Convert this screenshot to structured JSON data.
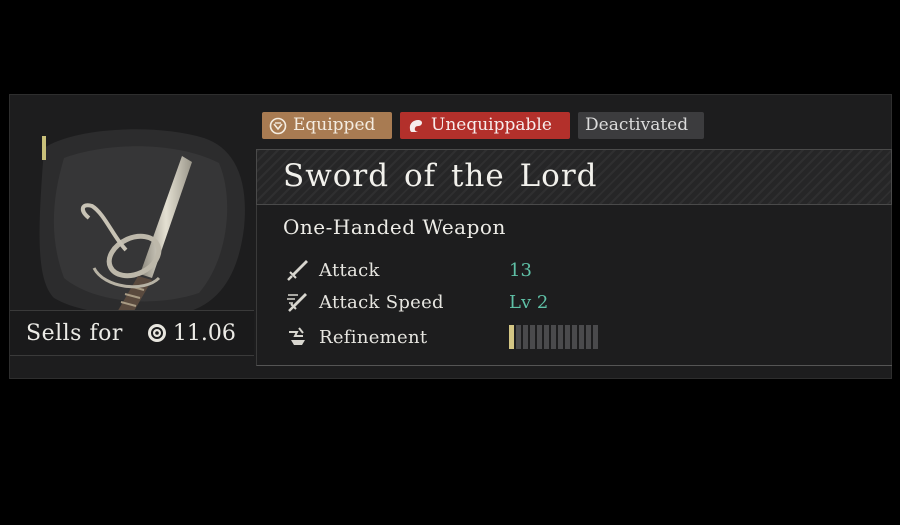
{
  "tags": {
    "equipped": {
      "label": "Equipped",
      "color": "#a87b52",
      "icon": "equipped-icon"
    },
    "unequippable": {
      "label": "Unequippable",
      "color": "#b3302b",
      "icon": "unequippable-icon"
    },
    "deactivated": {
      "label": "Deactivated",
      "color": "#3c3c3e"
    }
  },
  "item": {
    "name": "Sword of the Lord",
    "type": "One-Handed Weapon",
    "image": "rapier-sword-art"
  },
  "sell": {
    "label": "Sells for",
    "value": "11.06",
    "icon": "coin-icon"
  },
  "stats": {
    "attack": {
      "label": "Attack",
      "value": "13",
      "icon": "sword-icon"
    },
    "attack_speed": {
      "label": "Attack Speed",
      "value": "Lv 2",
      "icon": "speed-icon"
    },
    "refinement": {
      "label": "Refinement",
      "level": 1,
      "max": 13,
      "icon": "refinement-icon"
    }
  },
  "colors": {
    "stat_value": "#5fc0a6",
    "refine_filled": "#d4c684",
    "refine_empty": "#4a4a4c"
  }
}
